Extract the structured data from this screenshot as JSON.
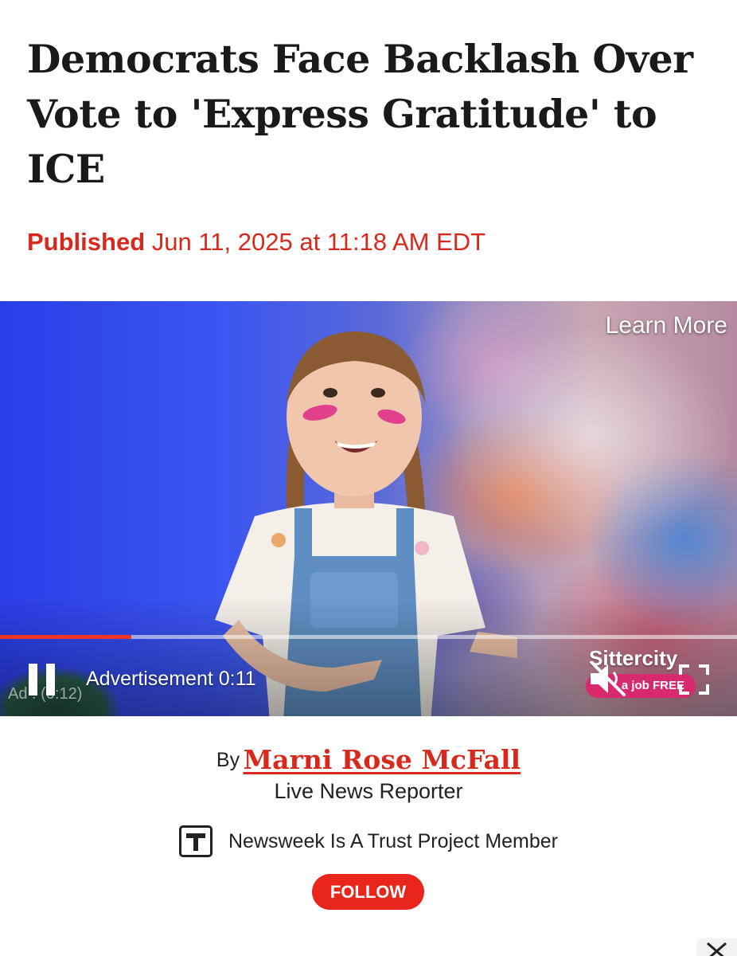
{
  "article": {
    "headline": "Democrats Face Backlash Over Vote to 'Express Gratitude' to ICE",
    "published_label": "Published",
    "published_date": "Jun 11, 2025 at 11:18 AM EDT"
  },
  "video_ad": {
    "learn_more": "Learn More",
    "ad_label": "Advertisement 0:11",
    "ad_overlay": "Ad : (0:12)",
    "brand": "Sittercity",
    "brand_tagline": "a job FREE",
    "progress_fraction": 0.178,
    "icons": [
      "pause-icon",
      "muted-speaker-icon",
      "fullscreen-icon"
    ]
  },
  "byline": {
    "by": "By",
    "author": "Marni Rose McFall",
    "role": "Live News Reporter"
  },
  "trust": {
    "icon": "trust-project-icon",
    "text": "Newsweek Is A Trust Project Member"
  },
  "follow_button": "FOLLOW",
  "colors": {
    "accent_red": "#d9291c",
    "follow_red": "#e8261c",
    "headline": "#1a1a1a"
  }
}
